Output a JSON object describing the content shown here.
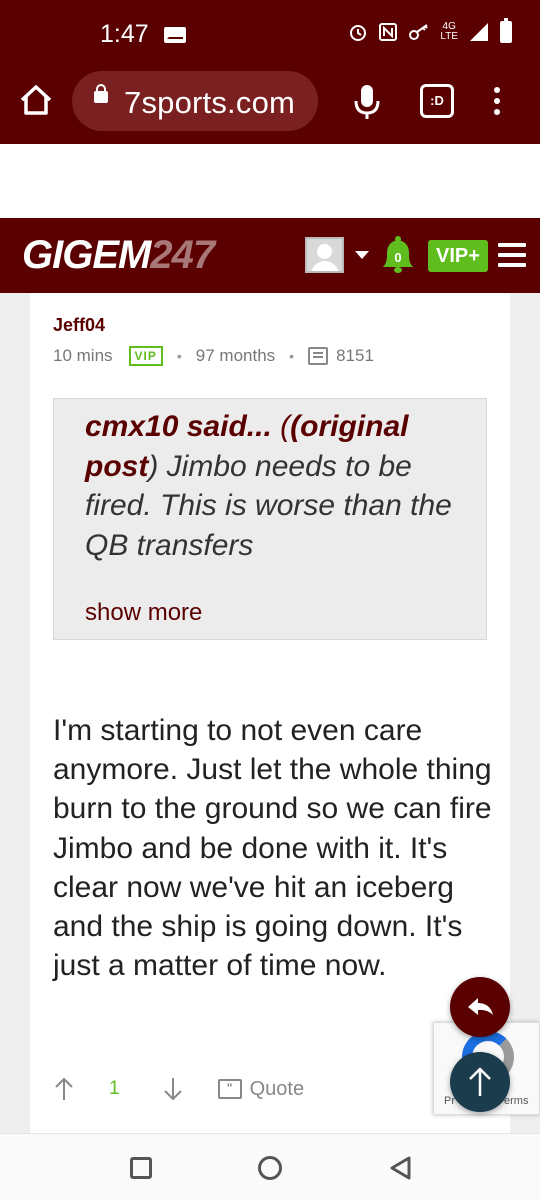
{
  "status_bar": {
    "time": "1:47",
    "network": "4G",
    "network_sub": "LTE",
    "icons": [
      "mail-icon",
      "alarm-icon",
      "nfc-icon",
      "key-icon",
      "signal-icon",
      "battery-icon"
    ]
  },
  "browser": {
    "url": "7sports.com",
    "tab_label": ":D"
  },
  "site": {
    "logo_text": "GIGEM",
    "logo_num": "247",
    "notification_count": "0",
    "vip_label": "VIP+"
  },
  "post": {
    "author": "Jeff04",
    "time_ago": "10 mins",
    "badge": "VIP",
    "tenure": "97 months",
    "post_count": "8151",
    "quote": {
      "attribution": "cmx10 said... (original post)",
      "attribution_a": "cmx10 said...",
      "attribution_b": "(original",
      "attribution_c": "post",
      "attribution_d": ")",
      "text": "Jimbo needs to be fired. This is worse than the QB transfers",
      "show_more": "show more"
    },
    "body": "I'm starting to not even care anymore. Just let the whole thing burn to the ground so we can fire Jimbo and be done with it. It's clear now we've hit an iceberg and the ship is going down. It's just a matter of time now.",
    "upvotes": "1",
    "quote_label": "Quote"
  },
  "recaptcha": {
    "text_left": "Pr",
    "text_right": "erms"
  },
  "colors": {
    "brand": "#5a0000",
    "vip_green": "#5fbe1e",
    "fab_top": "#1a3c4c"
  }
}
